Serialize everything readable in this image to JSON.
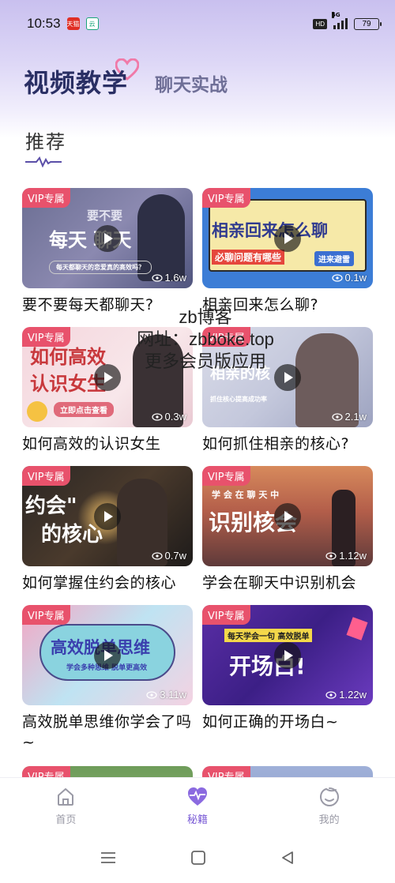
{
  "status_bar": {
    "time": "10:53",
    "app_badge_1": "天猫",
    "app_badge_2": "云",
    "hd": "HD",
    "network": "5G",
    "battery": "79"
  },
  "header": {
    "active_tab": "视频教学",
    "inactive_tab": "聊天实战"
  },
  "section": {
    "title": "推荐"
  },
  "watermark": {
    "line1": "zb博客",
    "line2": "网址：zbboke.top",
    "line3": "更多会员版应用"
  },
  "videos": [
    {
      "badge": "VIP专属",
      "views": "1.6w",
      "title": "要不要每天都聊天?",
      "thumb_line1": "要不要",
      "thumb_line2": "每天 聊天",
      "thumb_line3": "每天都聊天的恋爱真的高效吗？"
    },
    {
      "badge": "VIP专属",
      "views": "0.1w",
      "title": "相亲回来怎么聊?",
      "thumb_line1": "相亲回来怎么聊",
      "thumb_line2": "必聊问题有哪些",
      "thumb_line3": "进来避雷"
    },
    {
      "badge": "VIP专属",
      "views": "0.3w",
      "title": "如何高效的认识女生",
      "thumb_line1": "如何高效",
      "thumb_line2": "认识女生",
      "thumb_line3": "立即点击查看"
    },
    {
      "badge": "VIP专属",
      "views": "2.1w",
      "title": "如何抓住相亲的核心?",
      "thumb_line1": "相亲的核",
      "thumb_line2": "抓住核心提高成功率",
      "thumb_line3": ""
    },
    {
      "badge": "VIP专属",
      "views": "0.7w",
      "title": "如何掌握住约会的核心",
      "thumb_line1": "约会\"",
      "thumb_line2": "的核心",
      "thumb_line3": ""
    },
    {
      "badge": "VIP专属",
      "views": "1.12w",
      "title": "学会在聊天中识别机会",
      "thumb_line1": "学 会 在 聊 天 中",
      "thumb_line2": "识别核会",
      "thumb_line3": ""
    },
    {
      "badge": "VIP专属",
      "views": "3.11w",
      "title": "高效脱单思维你学会了吗~",
      "thumb_line1": "高效脱单思维",
      "thumb_line2": "学会多种思维 脱单更高效",
      "thumb_line3": ""
    },
    {
      "badge": "VIP专属",
      "views": "1.22w",
      "title": "如何正确的开场白~",
      "thumb_line1": "每天学会一句 高效脱单",
      "thumb_line2": "开场白!",
      "thumb_line3": ""
    },
    {
      "badge": "VIP专属"
    },
    {
      "badge": "VIP专属"
    }
  ],
  "bottom_nav": {
    "home": "首页",
    "secrets": "秘籍",
    "mine": "我的"
  },
  "colors": {
    "accent": "#7b5cd6",
    "vip": "#e8526c",
    "title_dark": "#2a2f64"
  }
}
